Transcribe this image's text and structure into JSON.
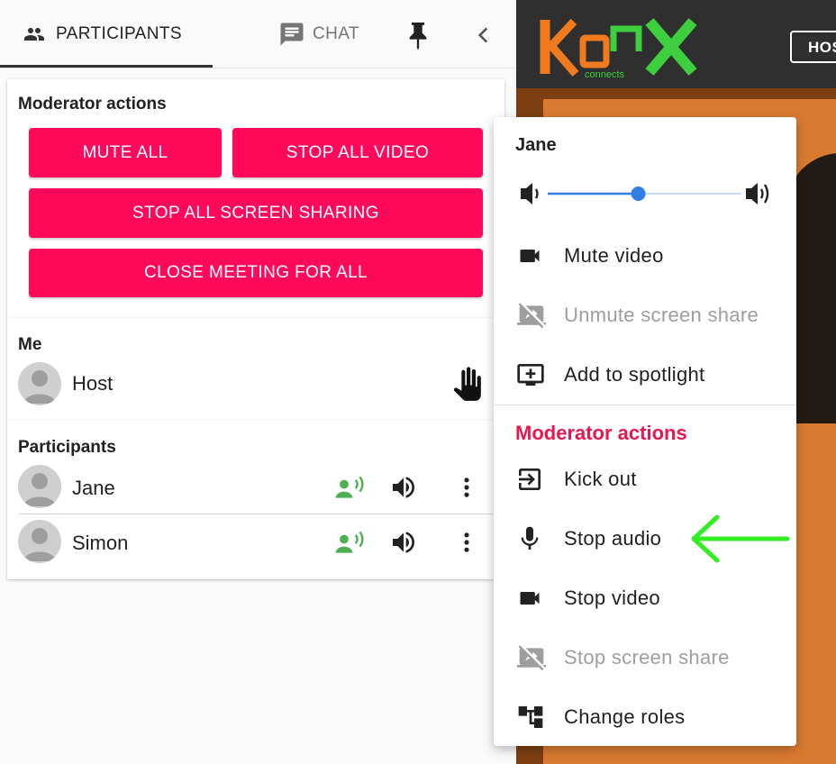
{
  "colors": {
    "accent_pink": "#ff0a5a",
    "moderator_title": "#e8174f",
    "talking_green": "#4caf50",
    "slider_blue": "#2f7fe6",
    "annotation_arrow": "#33ee22"
  },
  "tabs": {
    "participants": {
      "label": "PARTICIPANTS",
      "icon": "people-icon"
    },
    "chat": {
      "label": "CHAT",
      "icon": "chat-icon"
    },
    "pin_icon": "pin-icon",
    "collapse_icon": "chevron-left-icon"
  },
  "meeting": {
    "logo_text": "KONX connects",
    "host_chip_label": "HOS"
  },
  "moderator_panel": {
    "title": "Moderator actions",
    "buttons": {
      "mute_all": "MUTE ALL",
      "stop_all_video": "STOP ALL VIDEO",
      "stop_all_screen_sharing": "STOP ALL SCREEN SHARING",
      "close_meeting": "CLOSE MEETING FOR ALL"
    }
  },
  "me_section": {
    "title": "Me",
    "name": "Host",
    "icon": "raised-hand-icon"
  },
  "participants_section": {
    "title": "Participants",
    "rows": [
      {
        "name": "Jane",
        "icons": [
          "talking-icon",
          "volume-icon",
          "more-vertical-icon"
        ]
      },
      {
        "name": "Simon",
        "icons": [
          "talking-icon",
          "volume-icon",
          "more-vertical-icon"
        ]
      }
    ]
  },
  "participant_menu": {
    "name": "Jane",
    "volume_level": 0.47,
    "items": {
      "mute_video": "Mute video",
      "unmute_screen_share": "Unmute screen share",
      "add_to_spotlight": "Add to spotlight"
    },
    "moderator_title": "Moderator actions",
    "moderator_items": {
      "kick_out": "Kick out",
      "stop_audio": "Stop audio",
      "stop_video": "Stop video",
      "stop_screen_share": "Stop screen share",
      "change_roles": "Change roles"
    }
  }
}
